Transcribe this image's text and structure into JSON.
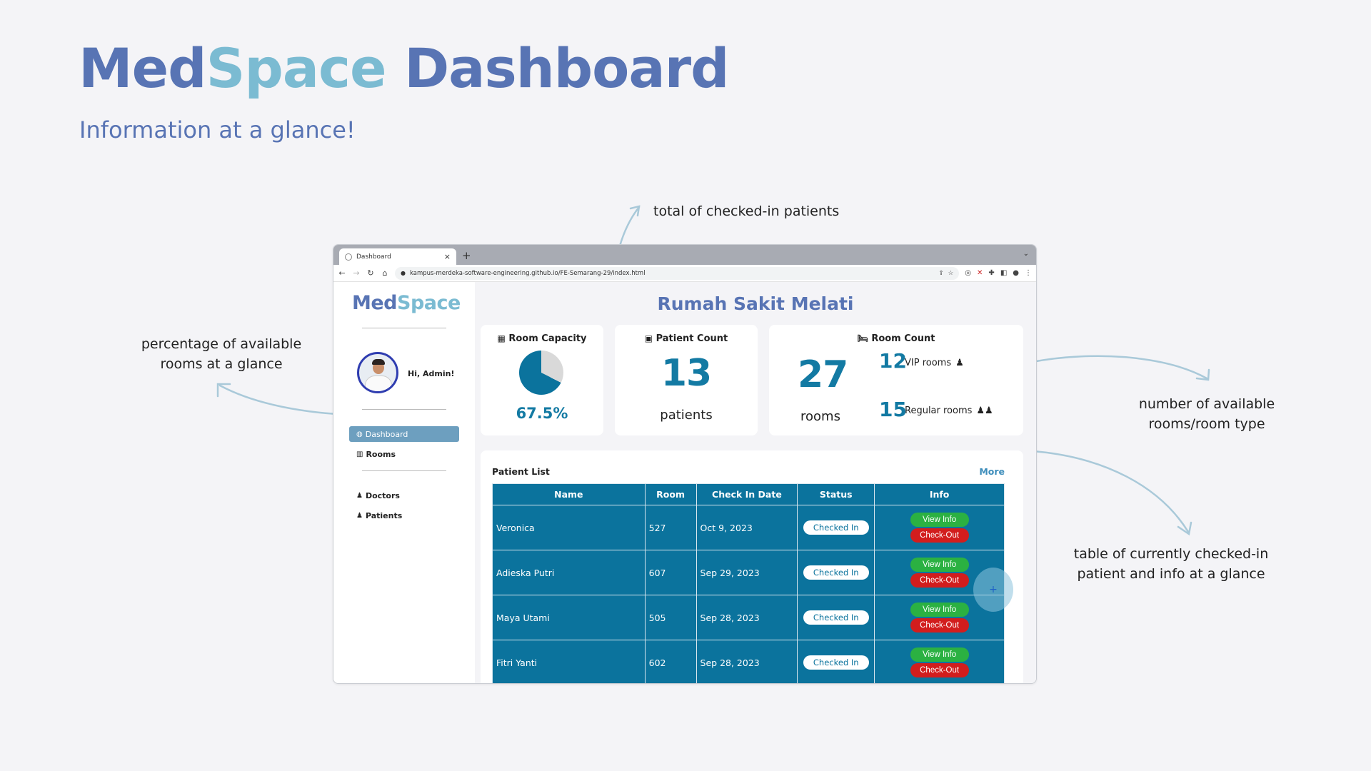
{
  "hero": {
    "title_part1": "Med",
    "title_part2": "Space",
    "title_part3": " Dashboard",
    "subtitle": "Information at a glance!"
  },
  "annotations": {
    "checked_in": "total of checked-in patients",
    "percentage_line1": "percentage of available",
    "percentage_line2": "rooms at a glance",
    "room_types_line1": "number of available",
    "room_types_line2": "rooms/room type",
    "table_line1": "table of currently checked-in",
    "table_line2": "patient and info at a glance"
  },
  "browser": {
    "tab_title": "Dashboard",
    "url": "kampus-merdeka-software-engineering.github.io/FE-Semarang-29/index.html"
  },
  "sidebar": {
    "brand_part1": "Med",
    "brand_part2": "Space",
    "greeting": "Hi, Admin!",
    "items": [
      {
        "label": "Dashboard"
      },
      {
        "label": "Rooms"
      },
      {
        "label": "Doctors"
      },
      {
        "label": "Patients"
      }
    ]
  },
  "main": {
    "hospital_name": "Rumah Sakit Melati",
    "room_capacity": {
      "title": "Room Capacity",
      "percent_text": "67.5%",
      "percent_value": 67.5
    },
    "patient_count": {
      "title": "Patient Count",
      "value": "13",
      "label": "patients"
    },
    "room_count": {
      "title": "Room Count",
      "total": "27",
      "total_label": "rooms",
      "vip_value": "12",
      "vip_label": "VIP rooms",
      "regular_value": "15",
      "regular_label": "Regular rooms"
    },
    "patient_list": {
      "title": "Patient List",
      "more_label": "More",
      "columns": [
        "Name",
        "Room",
        "Check In Date",
        "Status",
        "Info"
      ],
      "rows": [
        {
          "name": "Veronica",
          "room": "527",
          "date": "Oct 9, 2023",
          "status": "Checked In"
        },
        {
          "name": "Adieska Putri",
          "room": "607",
          "date": "Sep 29, 2023",
          "status": "Checked In"
        },
        {
          "name": "Maya Utami",
          "room": "505",
          "date": "Sep 28, 2023",
          "status": "Checked In"
        },
        {
          "name": "Fitri Yanti",
          "room": "602",
          "date": "Sep 28, 2023",
          "status": "Checked In"
        }
      ],
      "view_info_label": "View Info",
      "checkout_label": "Check-Out"
    },
    "fab_icon": "+"
  },
  "colors": {
    "brand_dark": "#5874b4",
    "brand_light": "#7bbbd2",
    "accent_teal": "#137aa3",
    "table_bg": "#0b739d",
    "green": "#2bb142",
    "red": "#d21d1d"
  }
}
